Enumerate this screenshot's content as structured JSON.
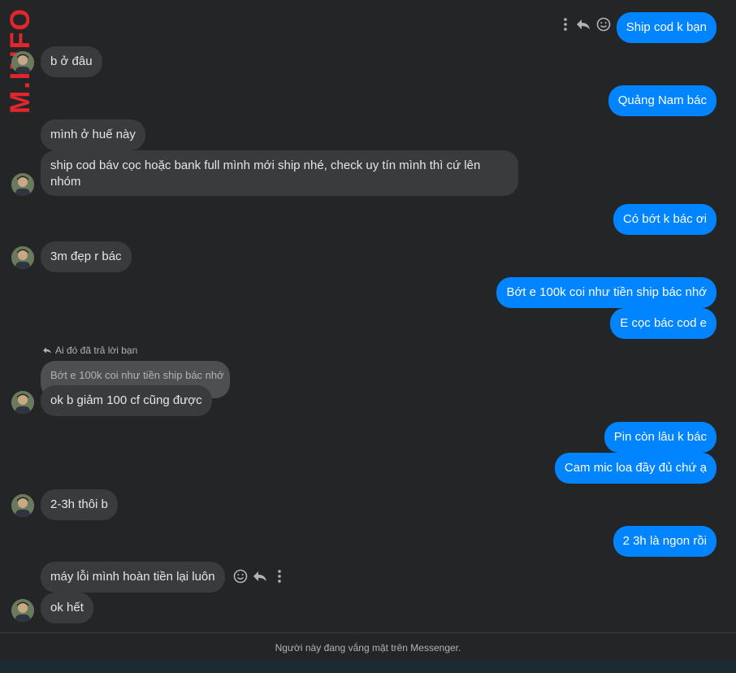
{
  "watermark": "M.INFO",
  "messages": [
    {
      "side": "out",
      "text": "Ship cod k bạn"
    },
    {
      "side": "in",
      "text": "b ở đâu"
    },
    {
      "side": "out",
      "text": "Quảng Nam bác"
    },
    {
      "side": "in",
      "text": "mình ở huế này"
    },
    {
      "side": "in",
      "text": "ship cod báv cọc hoặc bank full mình mới ship nhé, check uy tín mình thì cứ lên nhóm"
    },
    {
      "side": "out",
      "text": "Có bớt k bác ơi"
    },
    {
      "side": "in",
      "text": "3m đẹp r bác"
    },
    {
      "side": "out",
      "text": "Bớt e 100k coi như tiền ship bác nhớ"
    },
    {
      "side": "out",
      "text": "E cọc bác cod e"
    },
    {
      "side": "in",
      "text": "ok b giảm 100 cf cũng được"
    },
    {
      "side": "out",
      "text": "Pin còn lâu k bác"
    },
    {
      "side": "out",
      "text": "Cam mic loa đầy đủ chứ ạ"
    },
    {
      "side": "in",
      "text": "2-3h thôi b"
    },
    {
      "side": "out",
      "text": "2 3h là ngon rồi"
    },
    {
      "side": "in",
      "text": "máy lỗi mình hoàn tiền lại luôn"
    },
    {
      "side": "in",
      "text": "ok hết"
    }
  ],
  "reply": {
    "note": "Ai đó đã trả lời bạn",
    "quoted": "Bớt e 100k coi như tiền ship bác nhớ"
  },
  "footer": {
    "status": "Người này đang vắng mặt trên Messenger."
  },
  "colors": {
    "outgoing": "#0084ff",
    "incoming": "#3a3b3c",
    "background": "#242526"
  },
  "icons": [
    "more-icon",
    "reply-icon",
    "emoji-icon",
    "avatar"
  ]
}
